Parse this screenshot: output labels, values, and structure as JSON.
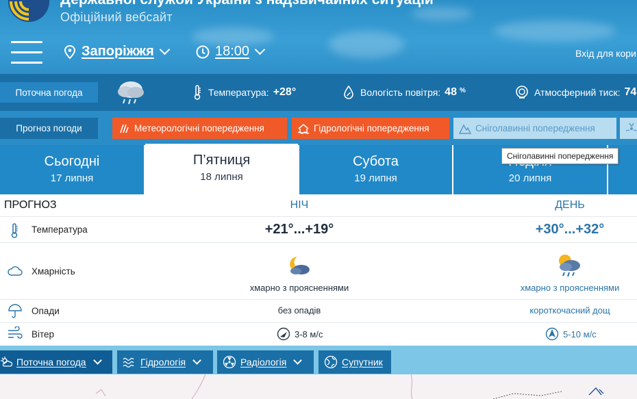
{
  "header": {
    "title": "Державної служби України з надзвичайних ситуацій",
    "subtitle": "Офіційний вебсайт",
    "city": "Запоріжжя",
    "time": "18:00",
    "login": "Вхід для кори"
  },
  "current": {
    "tag": "Поточна погода",
    "temp_label": "Температура:",
    "temp_value": "+28°",
    "humidity_label": "Вологість повітря:",
    "humidity_value": "48",
    "humidity_unit": "%",
    "pressure_label": "Атмосферний тиск:",
    "pressure_value": "74"
  },
  "forecast_bar": {
    "tag": "Прогноз погоди",
    "warnings": [
      {
        "label": "Метеорологічні попередження"
      },
      {
        "label": "Гідрологічні попередження"
      },
      {
        "label": "Сніголавинні попередження"
      }
    ]
  },
  "tooltip": "Сніголавинні попередження",
  "days": [
    {
      "name": "Сьогодні",
      "date": "17 липня"
    },
    {
      "name": "П’ятниця",
      "date": "18 липня"
    },
    {
      "name": "Субота",
      "date": "19 липня"
    },
    {
      "name": "Неділя",
      "date": "20 липня"
    }
  ],
  "table": {
    "heading": "ПРОГНОЗ",
    "night": "НІЧ",
    "day": "ДЕНЬ",
    "temp_label": "Температура",
    "night_temp": "+21°...+19°",
    "day_temp": "+30°...+32°",
    "cloud_label": "Хмарність",
    "night_cloud": "хмарно з проясненнями",
    "day_cloud": "хмарно з проясненнями",
    "precip_label": "Опади",
    "night_precip": "без опадів",
    "day_precip": "короткочасний дощ",
    "wind_label": "Вітер",
    "night_wind": "3-8 м/с",
    "day_wind": "5-10 м/с"
  },
  "bottom_nav": [
    {
      "label": "Поточна погода"
    },
    {
      "label": "Гідрологія"
    },
    {
      "label": "Радіологія"
    },
    {
      "label": "Супутник"
    }
  ],
  "colors": {
    "accent": "#1a6fa6",
    "warning": "#f05a28",
    "header": "#3a9fd6"
  }
}
